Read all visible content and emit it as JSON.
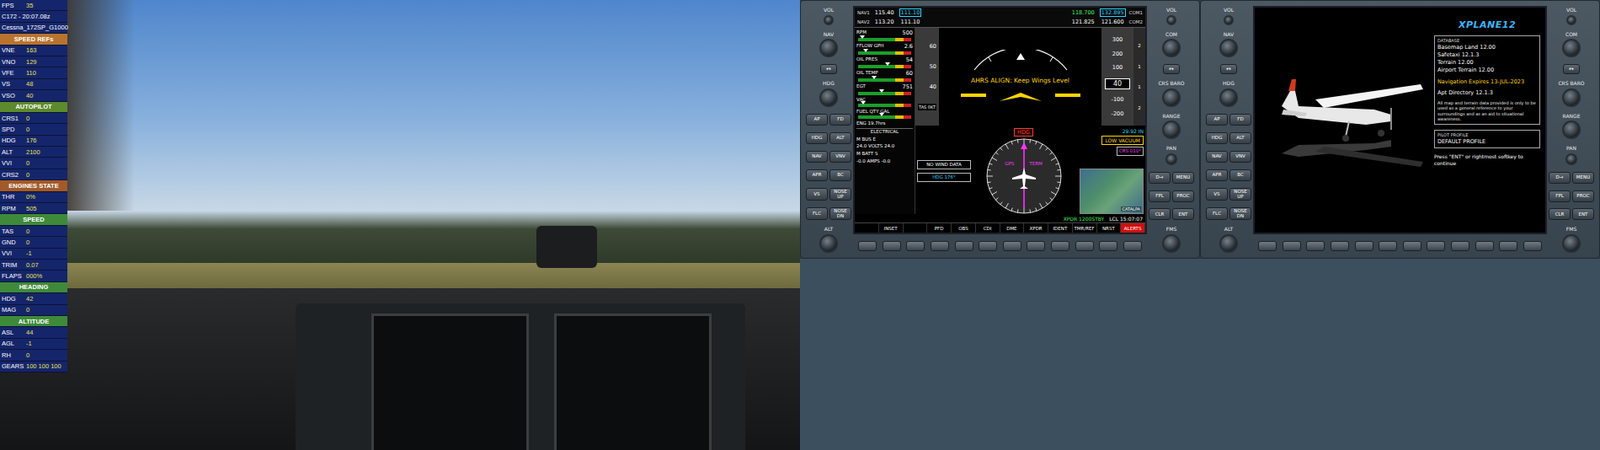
{
  "overlay": {
    "rows": [
      {
        "kind": "stat",
        "label": "FPS",
        "value": "35"
      },
      {
        "kind": "info",
        "text": "C172 - 20:07.08z"
      },
      {
        "kind": "info",
        "text": "Cessna_172SP_G1000"
      },
      {
        "kind": "header",
        "text": "SPEED REFs",
        "color": "#b8742e"
      },
      {
        "kind": "stat",
        "label": "VNE",
        "value": "163"
      },
      {
        "kind": "stat",
        "label": "VNO",
        "value": "129"
      },
      {
        "kind": "stat",
        "label": "VFE",
        "value": "110"
      },
      {
        "kind": "stat",
        "label": "VS",
        "value": "48"
      },
      {
        "kind": "stat",
        "label": "VSO",
        "value": "40"
      },
      {
        "kind": "header",
        "text": "AUTOPILOT",
        "color": "#5d8a2c"
      },
      {
        "kind": "stat",
        "label": "CRS1",
        "value": "0"
      },
      {
        "kind": "stat",
        "label": "SPD",
        "value": "0"
      },
      {
        "kind": "stat",
        "label": "HDG",
        "value": "176"
      },
      {
        "kind": "stat",
        "label": "ALT",
        "value": "2100"
      },
      {
        "kind": "stat",
        "label": "VVI",
        "value": "0"
      },
      {
        "kind": "stat",
        "label": "CRS2",
        "value": "0"
      },
      {
        "kind": "header",
        "text": "ENGINES STATE",
        "color": "#a25a28"
      },
      {
        "kind": "stat",
        "label": "THR",
        "value": "0%"
      },
      {
        "kind": "stat",
        "label": "RPM",
        "value": "505"
      },
      {
        "kind": "header",
        "text": "SPEED",
        "color": "#3e8a3a"
      },
      {
        "kind": "stat",
        "label": "TAS",
        "value": "0"
      },
      {
        "kind": "stat",
        "label": "GND",
        "value": "0"
      },
      {
        "kind": "stat",
        "label": "VVI",
        "value": "-1"
      },
      {
        "kind": "stat",
        "label": "TRIM",
        "value": "0.07"
      },
      {
        "kind": "stat",
        "label": "FLAPS",
        "value": "000%"
      },
      {
        "kind": "header",
        "text": "HEADING",
        "color": "#3e8a3a"
      },
      {
        "kind": "stat",
        "label": "HDG",
        "value": "42"
      },
      {
        "kind": "stat",
        "label": "MAG",
        "value": "0"
      },
      {
        "kind": "header",
        "text": "ALTITUDE",
        "color": "#3e8a3a"
      },
      {
        "kind": "stat",
        "label": "ASL",
        "value": "44"
      },
      {
        "kind": "stat",
        "label": "AGL",
        "value": "-1"
      },
      {
        "kind": "stat",
        "label": "RH",
        "value": "0"
      },
      {
        "kind": "stat",
        "label": "GEARS",
        "value": "100 100 100"
      }
    ]
  },
  "bezel": {
    "left": [
      {
        "kind": "small-knob",
        "label": "VOL"
      },
      {
        "kind": "knob",
        "label": "NAV"
      },
      {
        "kind": "swap",
        "label": "↔"
      },
      {
        "kind": "knob",
        "label": "HDG"
      },
      {
        "kind": "pair",
        "labels": [
          "AP",
          "FD"
        ]
      },
      {
        "kind": "pair",
        "labels": [
          "HDG",
          "ALT"
        ]
      },
      {
        "kind": "pair",
        "labels": [
          "NAV",
          "VNV"
        ]
      },
      {
        "kind": "pair",
        "labels": [
          "APR",
          "BC"
        ]
      },
      {
        "kind": "pair",
        "labels": [
          "VS",
          "NOSE UP"
        ]
      },
      {
        "kind": "pair",
        "labels": [
          "FLC",
          "NOSE DN"
        ]
      },
      {
        "kind": "knob",
        "label": "ALT"
      }
    ],
    "right": [
      {
        "kind": "small-knob",
        "label": "VOL"
      },
      {
        "kind": "knob",
        "label": "COM"
      },
      {
        "kind": "swap",
        "label": "↔"
      },
      {
        "kind": "knob",
        "label": "CRS BARO"
      },
      {
        "kind": "knob",
        "label": "RANGE"
      },
      {
        "kind": "joystick",
        "label": "PAN"
      },
      {
        "kind": "pair",
        "labels": [
          "D→",
          "MENU"
        ]
      },
      {
        "kind": "pair",
        "labels": [
          "FPL",
          "PROC"
        ]
      },
      {
        "kind": "pair",
        "labels": [
          "CLR",
          "ENT"
        ]
      },
      {
        "kind": "knob",
        "label": "FMS"
      }
    ]
  },
  "pfd": {
    "nav": [
      {
        "name": "NAV1",
        "active": "115.40",
        "standby": "111.10",
        "selected": true
      },
      {
        "name": "NAV2",
        "active": "113.20",
        "standby": "111.10",
        "selected": false
      }
    ],
    "com": [
      {
        "name": "COM1",
        "active": "118.700",
        "standby": "132.895",
        "selected": true
      },
      {
        "name": "COM2",
        "active": "121.825",
        "standby": "121.600",
        "selected": false
      }
    ],
    "engine": [
      {
        "kind": "gauge",
        "label": "RPM",
        "value": "500",
        "level": 0.08
      },
      {
        "kind": "gauge",
        "label": "FFLOW GPH",
        "value": "2.6",
        "level": 0.15
      },
      {
        "kind": "gauge",
        "label": "OIL PRES",
        "value": "54",
        "level": 0.55
      },
      {
        "kind": "gauge",
        "label": "OIL TEMP",
        "value": "60",
        "level": 0.3
      },
      {
        "kind": "gauge",
        "label": "EGT",
        "value": "751",
        "level": 0.45
      },
      {
        "kind": "gauge",
        "label": "VAC",
        "value": "",
        "level": 0.1
      },
      {
        "kind": "gauge",
        "label": "FUEL QTY GAL",
        "value": "",
        "level": 0.45
      },
      {
        "kind": "line",
        "text": "ENG 19.7hrs"
      },
      {
        "kind": "header",
        "text": "ELECTRICAL"
      },
      {
        "kind": "line",
        "text": "M BUS E"
      },
      {
        "kind": "line",
        "text": "24.0 VOLTS 24.0"
      },
      {
        "kind": "line",
        "text": "M BATT S"
      },
      {
        "kind": "line",
        "text": "-0.0 AMPS -0.0"
      }
    ],
    "speed_tape": [
      "60",
      "50",
      "40"
    ],
    "tas": "TAS 0KT",
    "ahrs": "AHRS ALIGN: Keep Wings Level",
    "alt_upper": [
      "300",
      "200",
      "100"
    ],
    "alt_current": "40",
    "alt_lower": [
      "-100",
      "-200"
    ],
    "vsi": [
      "2",
      "1",
      "1",
      "2"
    ],
    "baro": "29.92 IN",
    "alert": "LOW VACUUM",
    "hsi": {
      "flag": "HDG",
      "hdg": "HDG 176°",
      "crs": "CRS 010°",
      "source": "GPS",
      "phase": "TERM",
      "wind": "NO WIND DATA"
    },
    "map_labels": [
      "CATALPA"
    ],
    "xpdr": "XPDR 1200STBY",
    "clock": "LCL 15:07:07",
    "softkeys": [
      {
        "label": "",
        "alert": false
      },
      {
        "label": "INSET",
        "alert": false
      },
      {
        "label": "",
        "alert": false
      },
      {
        "label": "PFD",
        "alert": false
      },
      {
        "label": "OBS",
        "alert": false
      },
      {
        "label": "CDI",
        "alert": false
      },
      {
        "label": "DME",
        "alert": false
      },
      {
        "label": "XPDR",
        "alert": false
      },
      {
        "label": "IDENT",
        "alert": false
      },
      {
        "label": "TMR/REF",
        "alert": false
      },
      {
        "label": "NRST",
        "alert": false
      },
      {
        "label": "ALERTS",
        "alert": true
      }
    ]
  },
  "mfd": {
    "logo": "XPLANE12",
    "database": {
      "title": "DATABASE",
      "rows": [
        {
          "label": "Basemap Land",
          "value": "12.00",
          "warning": false
        },
        {
          "label": "Safetaxi",
          "value": "12.1.3",
          "warning": false
        },
        {
          "label": "Terrain",
          "value": "12.00",
          "warning": false
        },
        {
          "label": "Airport Terrain",
          "value": "12.00",
          "warning": false
        },
        {
          "label": "Navigation Expires",
          "value": "13-JUL-2023",
          "warning": true
        },
        {
          "label": "Apt Directory",
          "value": "12.1.3",
          "warning": false
        }
      ],
      "note": "All map and terrain data provided is only to be used as a general reference to your surroundings and as an aid to situational awareness."
    },
    "profile": {
      "title": "PILOT PROFILE",
      "value": "DEFAULT PROFILE"
    },
    "prompt": "Press \"ENT\" or rightmost softkey to continue",
    "softkey_count": 12
  }
}
